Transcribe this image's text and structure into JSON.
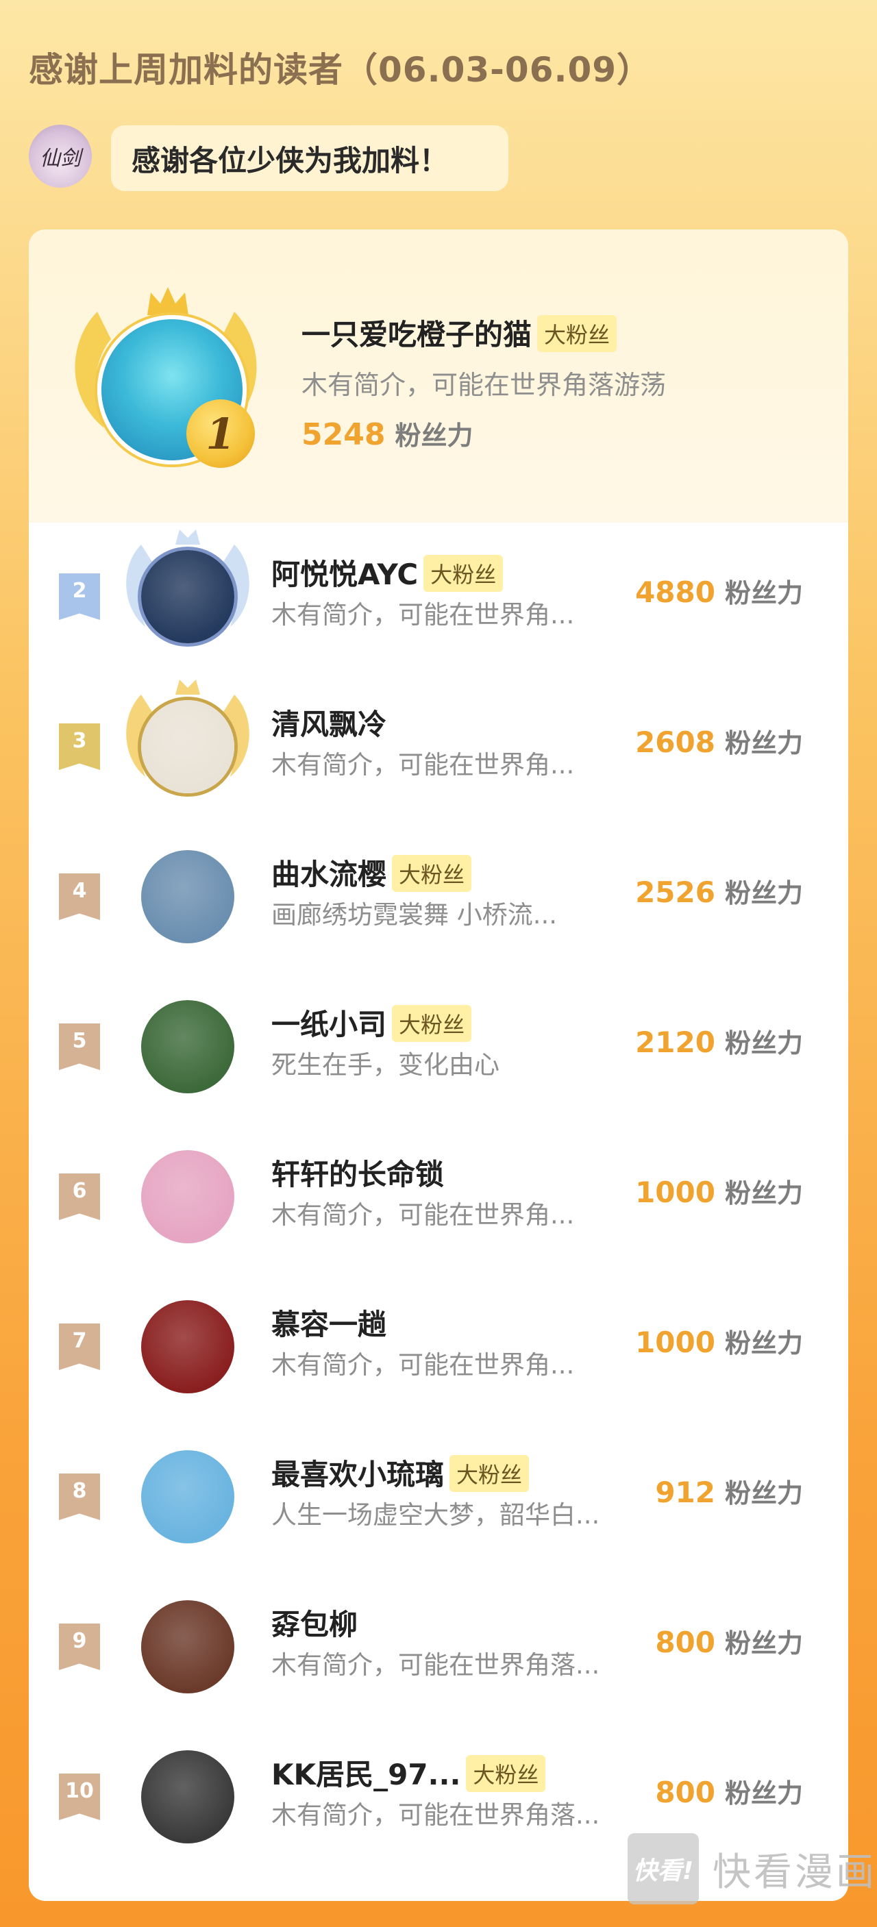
{
  "header": {
    "title": "感谢上周加料的读者（06.03-06.09）"
  },
  "host": {
    "avatar_text": "仙剑",
    "bubble_text": "感谢各位少侠为我加料！"
  },
  "fan_badge_label": "大粉丝",
  "score_unit": "粉丝力",
  "top1": {
    "rank": "1",
    "name": "一只爱吃橙子的猫",
    "has_badge": true,
    "bio": "木有简介，可能在世界角落游荡",
    "score": "5248"
  },
  "rows": [
    {
      "rank": "2",
      "name": "阿悦悦AYC",
      "has_badge": true,
      "bio": "木有简介，可能在世界角...",
      "score": "4880",
      "tag_color": "#a9c4ea",
      "frame": "silver"
    },
    {
      "rank": "3",
      "name": "清风飘冷",
      "has_badge": false,
      "bio": "木有简介，可能在世界角...",
      "score": "2608",
      "tag_color": "#e0c56b",
      "frame": "gold"
    },
    {
      "rank": "4",
      "name": "曲水流樱",
      "has_badge": true,
      "bio": "画廊绣坊霓裳舞 小桥流...",
      "score": "2526",
      "tag_color": "#d6b294",
      "frame": ""
    },
    {
      "rank": "5",
      "name": "一纸小司",
      "has_badge": true,
      "bio": "死生在手，变化由心",
      "score": "2120",
      "tag_color": "#d6b294",
      "frame": ""
    },
    {
      "rank": "6",
      "name": "轩轩的长命锁",
      "has_badge": false,
      "bio": "木有简介，可能在世界角...",
      "score": "1000",
      "tag_color": "#d6b294",
      "frame": ""
    },
    {
      "rank": "7",
      "name": "慕容一趟",
      "has_badge": false,
      "bio": "木有简介，可能在世界角...",
      "score": "1000",
      "tag_color": "#d6b294",
      "frame": ""
    },
    {
      "rank": "8",
      "name": "最喜欢小琉璃",
      "has_badge": true,
      "bio": "人生一场虚空大梦，韶华白...",
      "score": "912",
      "tag_color": "#d6b294",
      "frame": ""
    },
    {
      "rank": "9",
      "name": "孬包柳",
      "has_badge": false,
      "bio": "木有简介，可能在世界角落...",
      "score": "800",
      "tag_color": "#d6b294",
      "frame": ""
    },
    {
      "rank": "10",
      "name": "KK居民_97...",
      "has_badge": true,
      "bio": "木有简介，可能在世界角落...",
      "score": "800",
      "tag_color": "#d6b294",
      "frame": ""
    }
  ],
  "avatar_colors": [
    "#243a5e",
    "#e9e2d6",
    "#6b8fb0",
    "#3d6a3a",
    "#e6a5c2",
    "#8a1f1f",
    "#69b4e0",
    "#6b3a2a",
    "#3a3a3a"
  ],
  "watermark": {
    "logo_text": "快看!",
    "text": "快看漫画"
  }
}
